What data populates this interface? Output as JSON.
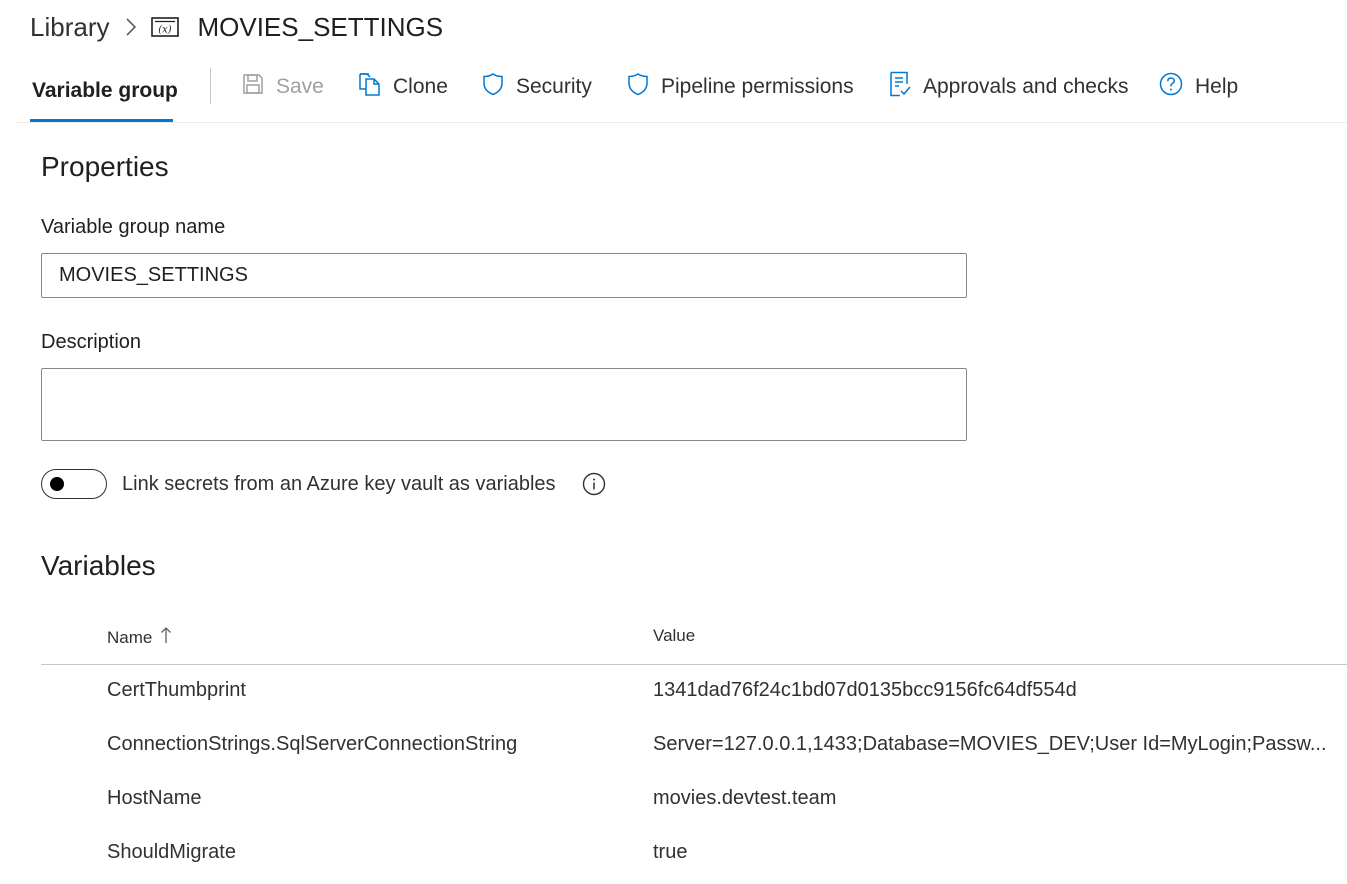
{
  "breadcrumb": {
    "root": "Library",
    "current": "MOVIES_SETTINGS"
  },
  "toolbar": {
    "tab_label": "Variable group",
    "save_label": "Save",
    "clone_label": "Clone",
    "security_label": "Security",
    "pipeline_permissions_label": "Pipeline permissions",
    "approvals_label": "Approvals and checks",
    "help_label": "Help"
  },
  "properties": {
    "heading": "Properties",
    "name_label": "Variable group name",
    "name_value": "MOVIES_SETTINGS",
    "description_label": "Description",
    "description_value": "",
    "keyvault_toggle_label": "Link secrets from an Azure key vault as variables",
    "keyvault_toggle_on": false
  },
  "variables": {
    "heading": "Variables",
    "columns": {
      "name": "Name",
      "value": "Value"
    },
    "rows": [
      {
        "name": "CertThumbprint",
        "value": "1341dad76f24c1bd07d0135bcc9156fc64df554d"
      },
      {
        "name": "ConnectionStrings.SqlServerConnectionString",
        "value": "Server=127.0.0.1,1433;Database=MOVIES_DEV;User Id=MyLogin;Passw..."
      },
      {
        "name": "HostName",
        "value": "movies.devtest.team"
      },
      {
        "name": "ShouldMigrate",
        "value": "true"
      }
    ]
  },
  "colors": {
    "accent": "#0078d4",
    "text": "#201f1e",
    "disabled": "#a19f9d",
    "border": "#8a8886"
  },
  "icons": {
    "breadcrumb_separator": "chevron-right-icon",
    "variable_group": "variable-group-icon",
    "save": "save-icon",
    "clone": "clone-icon",
    "security": "shield-icon",
    "pipeline_permissions": "shield-icon",
    "approvals": "checklist-icon",
    "help": "help-icon",
    "info": "info-icon",
    "sort": "sort-ascending-icon"
  }
}
